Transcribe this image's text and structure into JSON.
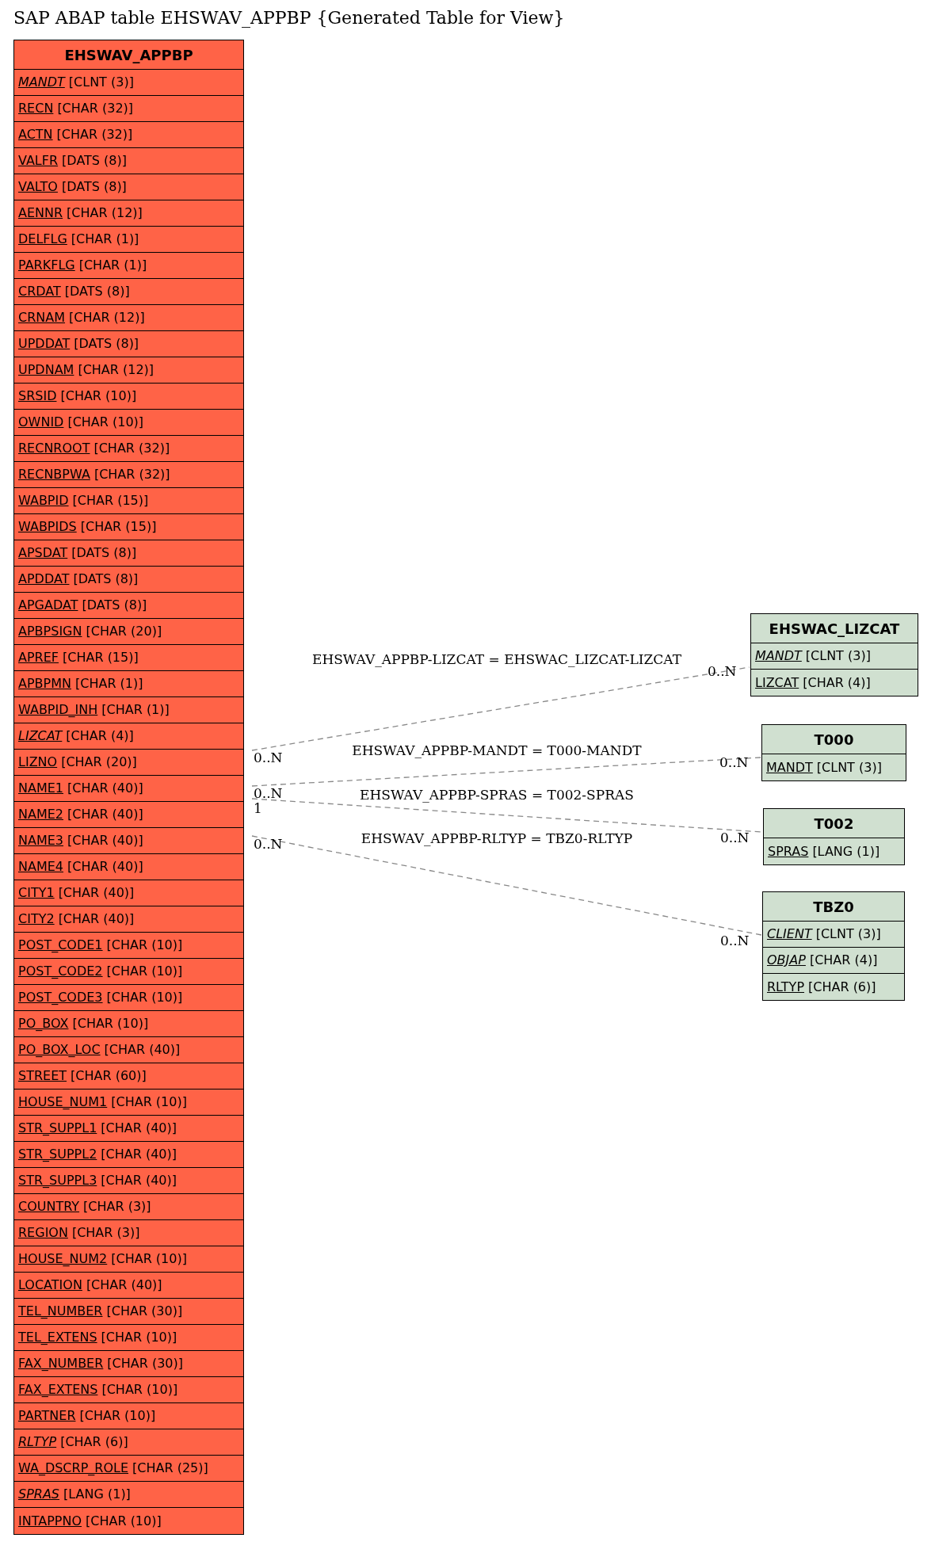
{
  "title": "SAP ABAP table EHSWAV_APPBP {Generated Table for View}",
  "tables": [
    {
      "name": "EHSWAV_APPBP",
      "color": "#ff6347",
      "fields": [
        {
          "name": "MANDT",
          "type": "[CLNT (3)]",
          "italic": true
        },
        {
          "name": "RECN",
          "type": "[CHAR (32)]",
          "italic": false
        },
        {
          "name": "ACTN",
          "type": "[CHAR (32)]",
          "italic": false
        },
        {
          "name": "VALFR",
          "type": "[DATS (8)]",
          "italic": false
        },
        {
          "name": "VALTO",
          "type": "[DATS (8)]",
          "italic": false
        },
        {
          "name": "AENNR",
          "type": "[CHAR (12)]",
          "italic": false
        },
        {
          "name": "DELFLG",
          "type": "[CHAR (1)]",
          "italic": false
        },
        {
          "name": "PARKFLG",
          "type": "[CHAR (1)]",
          "italic": false
        },
        {
          "name": "CRDAT",
          "type": "[DATS (8)]",
          "italic": false
        },
        {
          "name": "CRNAM",
          "type": "[CHAR (12)]",
          "italic": false
        },
        {
          "name": "UPDDAT",
          "type": "[DATS (8)]",
          "italic": false
        },
        {
          "name": "UPDNAM",
          "type": "[CHAR (12)]",
          "italic": false
        },
        {
          "name": "SRSID",
          "type": "[CHAR (10)]",
          "italic": false
        },
        {
          "name": "OWNID",
          "type": "[CHAR (10)]",
          "italic": false
        },
        {
          "name": "RECNROOT",
          "type": "[CHAR (32)]",
          "italic": false
        },
        {
          "name": "RECNBPWA",
          "type": "[CHAR (32)]",
          "italic": false
        },
        {
          "name": "WABPID",
          "type": "[CHAR (15)]",
          "italic": false
        },
        {
          "name": "WABPIDS",
          "type": "[CHAR (15)]",
          "italic": false
        },
        {
          "name": "APSDAT",
          "type": "[DATS (8)]",
          "italic": false
        },
        {
          "name": "APDDAT",
          "type": "[DATS (8)]",
          "italic": false
        },
        {
          "name": "APGADAT",
          "type": "[DATS (8)]",
          "italic": false
        },
        {
          "name": "APBPSIGN",
          "type": "[CHAR (20)]",
          "italic": false
        },
        {
          "name": "APREF",
          "type": "[CHAR (15)]",
          "italic": false
        },
        {
          "name": "APBPMN",
          "type": "[CHAR (1)]",
          "italic": false
        },
        {
          "name": "WABPID_INH",
          "type": "[CHAR (1)]",
          "italic": false
        },
        {
          "name": "LIZCAT",
          "type": "[CHAR (4)]",
          "italic": true
        },
        {
          "name": "LIZNO",
          "type": "[CHAR (20)]",
          "italic": false
        },
        {
          "name": "NAME1",
          "type": "[CHAR (40)]",
          "italic": false
        },
        {
          "name": "NAME2",
          "type": "[CHAR (40)]",
          "italic": false
        },
        {
          "name": "NAME3",
          "type": "[CHAR (40)]",
          "italic": false
        },
        {
          "name": "NAME4",
          "type": "[CHAR (40)]",
          "italic": false
        },
        {
          "name": "CITY1",
          "type": "[CHAR (40)]",
          "italic": false
        },
        {
          "name": "CITY2",
          "type": "[CHAR (40)]",
          "italic": false
        },
        {
          "name": "POST_CODE1",
          "type": "[CHAR (10)]",
          "italic": false
        },
        {
          "name": "POST_CODE2",
          "type": "[CHAR (10)]",
          "italic": false
        },
        {
          "name": "POST_CODE3",
          "type": "[CHAR (10)]",
          "italic": false
        },
        {
          "name": "PO_BOX",
          "type": "[CHAR (10)]",
          "italic": false
        },
        {
          "name": "PO_BOX_LOC",
          "type": "[CHAR (40)]",
          "italic": false
        },
        {
          "name": "STREET",
          "type": "[CHAR (60)]",
          "italic": false
        },
        {
          "name": "HOUSE_NUM1",
          "type": "[CHAR (10)]",
          "italic": false
        },
        {
          "name": "STR_SUPPL1",
          "type": "[CHAR (40)]",
          "italic": false
        },
        {
          "name": "STR_SUPPL2",
          "type": "[CHAR (40)]",
          "italic": false
        },
        {
          "name": "STR_SUPPL3",
          "type": "[CHAR (40)]",
          "italic": false
        },
        {
          "name": "COUNTRY",
          "type": "[CHAR (3)]",
          "italic": false
        },
        {
          "name": "REGION",
          "type": "[CHAR (3)]",
          "italic": false
        },
        {
          "name": "HOUSE_NUM2",
          "type": "[CHAR (10)]",
          "italic": false
        },
        {
          "name": "LOCATION",
          "type": "[CHAR (40)]",
          "italic": false
        },
        {
          "name": "TEL_NUMBER",
          "type": "[CHAR (30)]",
          "italic": false
        },
        {
          "name": "TEL_EXTENS",
          "type": "[CHAR (10)]",
          "italic": false
        },
        {
          "name": "FAX_NUMBER",
          "type": "[CHAR (30)]",
          "italic": false
        },
        {
          "name": "FAX_EXTENS",
          "type": "[CHAR (10)]",
          "italic": false
        },
        {
          "name": "PARTNER",
          "type": "[CHAR (10)]",
          "italic": false
        },
        {
          "name": "RLTYP",
          "type": "[CHAR (6)]",
          "italic": true
        },
        {
          "name": "WA_DSCRP_ROLE",
          "type": "[CHAR (25)]",
          "italic": false
        },
        {
          "name": "SPRAS",
          "type": "[LANG (1)]",
          "italic": true
        },
        {
          "name": "INTAPPNO",
          "type": "[CHAR (10)]",
          "italic": false
        }
      ]
    },
    {
      "name": "EHSWAC_LIZCAT",
      "color": "#d0e0d0",
      "fields": [
        {
          "name": "MANDT",
          "type": "[CLNT (3)]",
          "italic": true
        },
        {
          "name": "LIZCAT",
          "type": "[CHAR (4)]",
          "italic": false
        }
      ]
    },
    {
      "name": "T000",
      "color": "#d0e0d0",
      "fields": [
        {
          "name": "MANDT",
          "type": "[CLNT (3)]",
          "italic": false
        }
      ]
    },
    {
      "name": "T002",
      "color": "#d0e0d0",
      "fields": [
        {
          "name": "SPRAS",
          "type": "[LANG (1)]",
          "italic": false
        }
      ]
    },
    {
      "name": "TBZ0",
      "color": "#d0e0d0",
      "fields": [
        {
          "name": "CLIENT",
          "type": "[CLNT (3)]",
          "italic": true
        },
        {
          "name": "OBJAP",
          "type": "[CHAR (4)]",
          "italic": true
        },
        {
          "name": "RLTYP",
          "type": "[CHAR (6)]",
          "italic": false
        }
      ]
    }
  ],
  "relations": [
    {
      "label": "EHSWAV_APPBP-LIZCAT = EHSWAC_LIZCAT-LIZCAT",
      "from_cardinality": "0..N",
      "to_cardinality": "0..N"
    },
    {
      "label": "EHSWAV_APPBP-MANDT = T000-MANDT",
      "from_cardinality": "0..N",
      "to_cardinality": "0..N"
    },
    {
      "label": "EHSWAV_APPBP-SPRAS = T002-SPRAS",
      "from_cardinality": "1",
      "to_cardinality": "0..N"
    },
    {
      "label": "EHSWAV_APPBP-RLTYP = TBZ0-RLTYP",
      "from_cardinality": "0..N",
      "to_cardinality": "0..N"
    }
  ]
}
